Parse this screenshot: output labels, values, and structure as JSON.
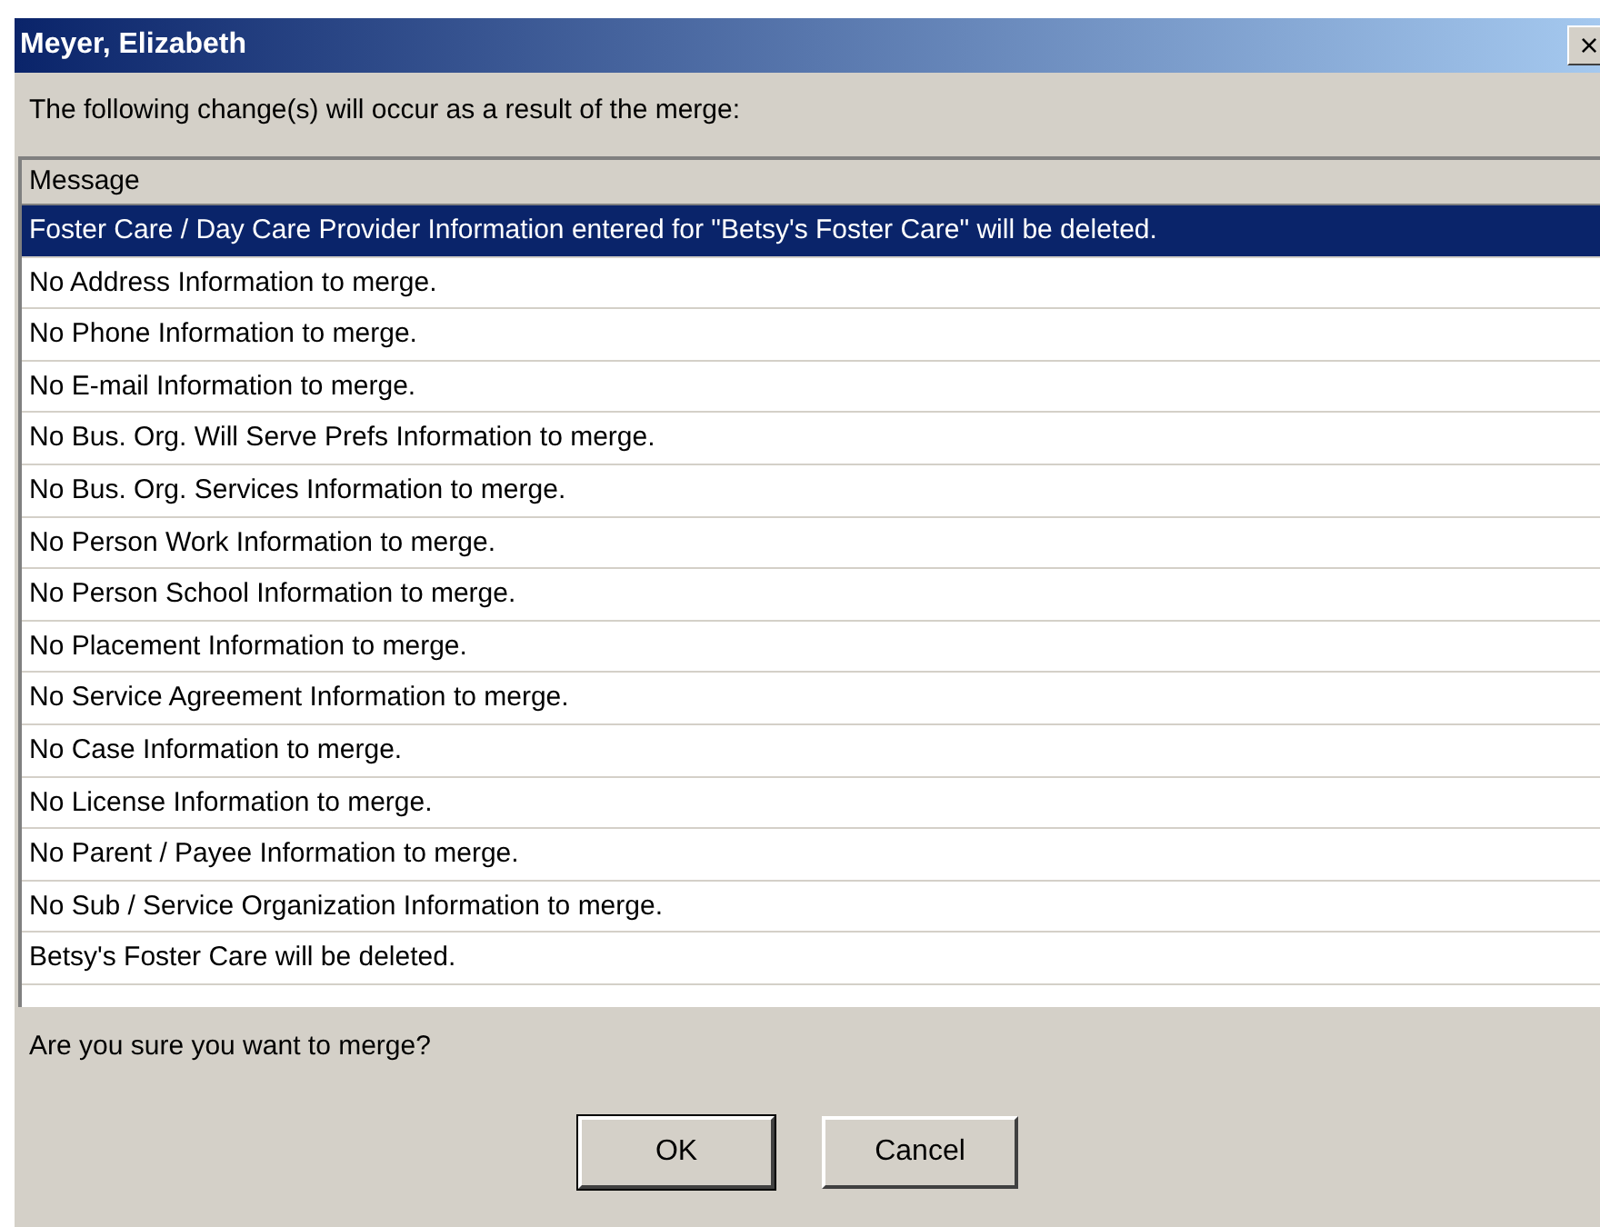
{
  "window": {
    "title": "Meyer, Elizabeth",
    "close": "×"
  },
  "intro": "The following change(s) will occur as a result of the merge:",
  "table": {
    "columns": [
      "Message"
    ],
    "rows": [
      {
        "message": "Foster Care / Day Care Provider Information entered for \"Betsy's Foster Care\" will be deleted.",
        "selected": true
      },
      {
        "message": "No Address Information to merge.",
        "selected": false
      },
      {
        "message": "No Phone Information to merge.",
        "selected": false
      },
      {
        "message": "No E-mail Information to merge.",
        "selected": false
      },
      {
        "message": "No Bus. Org. Will Serve Prefs Information to merge.",
        "selected": false
      },
      {
        "message": "No Bus. Org. Services Information to merge.",
        "selected": false
      },
      {
        "message": "No Person Work Information to merge.",
        "selected": false
      },
      {
        "message": "No Person School Information to merge.",
        "selected": false
      },
      {
        "message": "No Placement Information to merge.",
        "selected": false
      },
      {
        "message": "No Service Agreement Information to merge.",
        "selected": false
      },
      {
        "message": "No Case Information to merge.",
        "selected": false
      },
      {
        "message": "No License Information to merge.",
        "selected": false
      },
      {
        "message": "No Parent / Payee Information to merge.",
        "selected": false
      },
      {
        "message": "No Sub / Service Organization Information to merge.",
        "selected": false
      },
      {
        "message": "Betsy's Foster Care will be deleted.",
        "selected": false
      }
    ]
  },
  "question": "Are you sure you want to merge?",
  "buttons": [
    {
      "label": "OK",
      "default": true
    },
    {
      "label": "Cancel",
      "default": false
    }
  ]
}
